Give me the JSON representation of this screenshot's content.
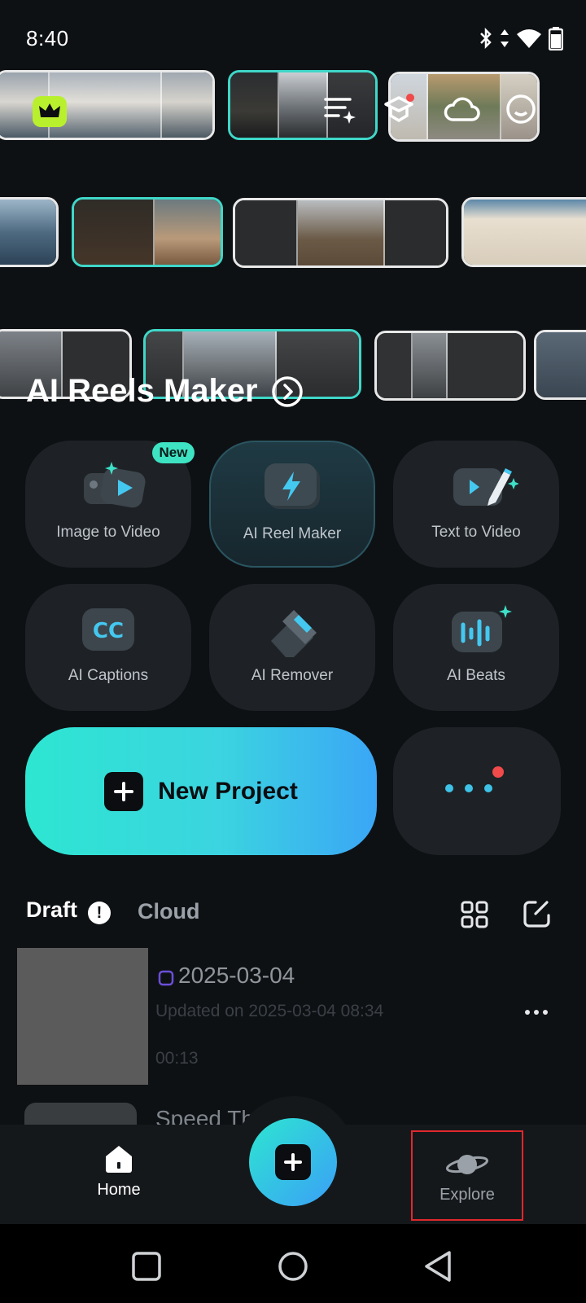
{
  "status_bar": {
    "time": "8:40"
  },
  "section": {
    "title": "AI Reels Maker"
  },
  "tools": [
    {
      "label": "Image to Video",
      "badge": "New"
    },
    {
      "label": "AI Reel Maker"
    },
    {
      "label": "Text to Video"
    },
    {
      "label": "AI Captions",
      "icon_text": "CC"
    },
    {
      "label": "AI Remover"
    },
    {
      "label": "AI Beats"
    }
  ],
  "new_project": {
    "label": "New Project"
  },
  "tabs": {
    "draft": "Draft",
    "cloud": "Cloud"
  },
  "drafts": [
    {
      "title": "2025-03-04",
      "updated": "Updated on 2025-03-04 08:34",
      "duration": "00:13"
    },
    {
      "title": "Speed Th"
    }
  ],
  "bottom_nav": {
    "home": "Home",
    "explore": "Explore"
  },
  "colors": {
    "accent_teal": "#3fd7c8",
    "accent_blue": "#3b9ff7",
    "highlight_box": "#e0282d",
    "notification": "#f04a4a"
  }
}
